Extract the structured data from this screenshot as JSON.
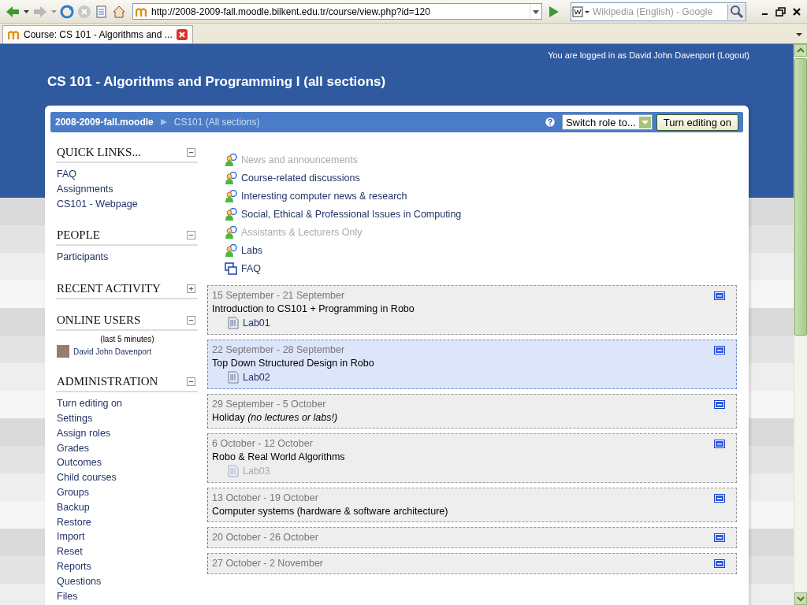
{
  "browser": {
    "url": "http://2008-2009-fall.moodle.bilkent.edu.tr/course/view.php?id=120",
    "search_placeholder": "Wikipedia (English) - Google",
    "tabs": [
      {
        "title": "Course: CS 101 - Algorithms and ...",
        "selected": true
      }
    ]
  },
  "header": {
    "login_text": "You are logged in as",
    "user": "David John Davenport",
    "logout": "(Logout)",
    "course_title": "CS 101 - Algorithms and Programming I (all sections)"
  },
  "navbar": {
    "breadcrumbs": [
      "2008-2009-fall.moodle",
      "CS101 (All sections)"
    ],
    "switch_role": "Switch role to...",
    "edit_button": "Turn editing on"
  },
  "blocks": [
    {
      "kind": "links",
      "title": "QUICK LINKS...",
      "expanded": true,
      "items": [
        "FAQ",
        "Assignments",
        "CS101 - Webpage"
      ]
    },
    {
      "kind": "links",
      "title": "PEOPLE",
      "expanded": true,
      "items": [
        "Participants"
      ]
    },
    {
      "kind": "links",
      "title": "RECENT ACTIVITY",
      "expanded": false
    },
    {
      "kind": "users",
      "title": "ONLINE USERS",
      "expanded": true,
      "note": "(last 5 minutes)",
      "users": [
        "David John Davenport"
      ]
    },
    {
      "kind": "links",
      "title": "ADMINISTRATION",
      "expanded": true,
      "items": [
        "Turn editing on",
        "Settings",
        "Assign roles",
        "Grades",
        "Outcomes",
        "Child courses",
        "Groups",
        "Backup",
        "Restore",
        "Import",
        "Reset",
        "Reports",
        "Questions",
        "Files"
      ]
    }
  ],
  "top_activities": [
    {
      "kind": "forum",
      "label": "News and announcements",
      "hidden": true
    },
    {
      "kind": "forum",
      "label": "Course-related discussions",
      "hidden": false
    },
    {
      "kind": "forum",
      "label": "Interesting computer news & research",
      "hidden": false
    },
    {
      "kind": "forum",
      "label": "Social, Ethical & Professional Issues in Computing",
      "hidden": false
    },
    {
      "kind": "forum",
      "label": "Assistants & Lecturers Only",
      "hidden": true
    },
    {
      "kind": "forum",
      "label": "Labs",
      "hidden": false
    },
    {
      "kind": "glossary",
      "label": "FAQ",
      "hidden": false
    }
  ],
  "sections": [
    {
      "dates": "15 September - 21 September",
      "title": "Introduction to CS101 + Programming in Robo",
      "selected": false,
      "items": [
        {
          "label": "Lab01",
          "hidden": false
        }
      ]
    },
    {
      "dates": "22 September - 28 September",
      "title": "Top Down Structured Design in Robo",
      "selected": true,
      "items": [
        {
          "label": "Lab02",
          "hidden": false
        }
      ]
    },
    {
      "dates": "29 September - 5 October",
      "title": "Holiday *(no lectures or labs!)*",
      "selected": false
    },
    {
      "dates": "6 October - 12 October",
      "title": "Robo & Real World Algorithms",
      "selected": false,
      "items": [
        {
          "label": "Lab03",
          "hidden": true
        }
      ]
    },
    {
      "dates": "13 October - 19 October",
      "title": "Computer systems (hardware & software architecture)",
      "selected": false
    },
    {
      "dates": "20 October - 26 October",
      "selected": false
    },
    {
      "dates": "27 October - 2 November",
      "selected": false
    }
  ]
}
